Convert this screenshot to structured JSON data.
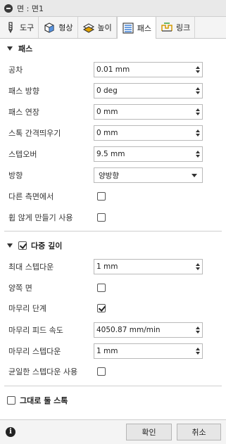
{
  "window": {
    "title": "면 : 면1",
    "icon": "minus-circle-icon"
  },
  "tabs": [
    {
      "label": "도구",
      "icon": "tool-icon"
    },
    {
      "label": "형상",
      "icon": "shape-cube-icon"
    },
    {
      "label": "높이",
      "icon": "height-icon"
    },
    {
      "label": "패스",
      "icon": "passes-icon",
      "active": true
    },
    {
      "label": "링크",
      "icon": "linking-icon"
    }
  ],
  "passes_section": {
    "title": "패스",
    "fields": {
      "tolerance": {
        "label": "공차",
        "value": "0.01 mm"
      },
      "pass_direction": {
        "label": "패스 방향",
        "value": "0 deg"
      },
      "pass_extension": {
        "label": "패스 연장",
        "value": "0 mm"
      },
      "stock_clearance": {
        "label": "스톡 간격띄우기",
        "value": "0 mm"
      },
      "stepover": {
        "label": "스텝오버",
        "value": "9.5 mm"
      },
      "direction": {
        "label": "방향",
        "value": "양방향"
      },
      "other_side": {
        "label": "다른 측면에서",
        "checked": false
      },
      "smoothing": {
        "label": "휩 않게 만들기 사용",
        "checked": false
      }
    }
  },
  "multiple_depths_section": {
    "title": "다중 깊이",
    "checked": true,
    "fields": {
      "max_stepdown": {
        "label": "최대 스텝다운",
        "value": "1 mm"
      },
      "both_ways": {
        "label": "양쪽 면",
        "checked": false
      },
      "finishing_step": {
        "label": "마무리 단계",
        "checked": true
      },
      "finishing_feedrate": {
        "label": "마무리 피드 속도",
        "value": "4050.87 mm/min"
      },
      "finishing_stepdown": {
        "label": "마무리 스텝다운",
        "value": "1 mm"
      },
      "even_stepdowns": {
        "label": "균일한 스텝다운 사용",
        "checked": false
      }
    }
  },
  "leave_stock": {
    "label": "그대로 둘 스톡",
    "checked": false
  },
  "footer": {
    "ok": "확인",
    "cancel": "취소"
  }
}
